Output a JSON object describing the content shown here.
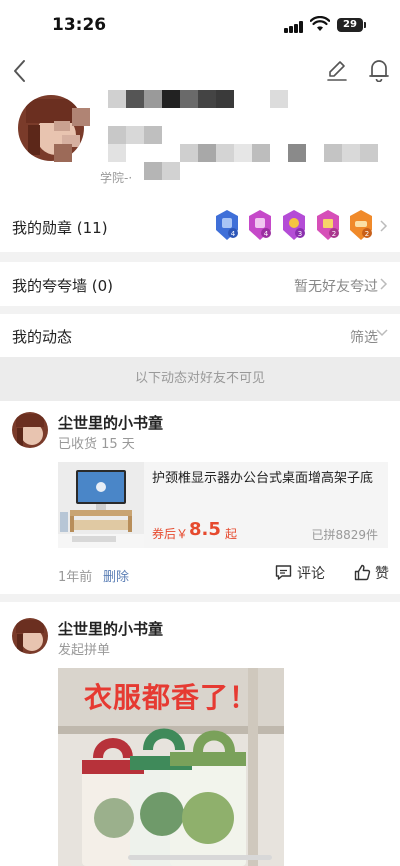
{
  "status_bar": {
    "time": "13:26",
    "battery": "29"
  },
  "profile": {
    "school_partial": "学院-·"
  },
  "medals_row": {
    "label": "我的勋章 (11)",
    "badge_levels": [
      "4",
      "4",
      "3",
      "2",
      "2"
    ]
  },
  "praise_row": {
    "label": "我的夸夸墙 (0)",
    "value": "暂无好友夸过"
  },
  "feed_header": {
    "label": "我的动态",
    "filter": "筛选"
  },
  "notice": "以下动态对好友不可见",
  "posts": [
    {
      "name": "尘世里的小书童",
      "sub": "已收货 15 天",
      "product": {
        "title": "护颈椎显示器办公台式桌面增高架子底",
        "price_label": "券后￥",
        "price": "8.5",
        "price_suffix": "起",
        "count": "已拼8829件"
      },
      "time": "1年前",
      "delete": "删除",
      "comment": "评论",
      "like": "赞"
    },
    {
      "name": "尘世里的小书童",
      "sub": "发起拼单",
      "image_text": "衣服都香了！"
    }
  ]
}
